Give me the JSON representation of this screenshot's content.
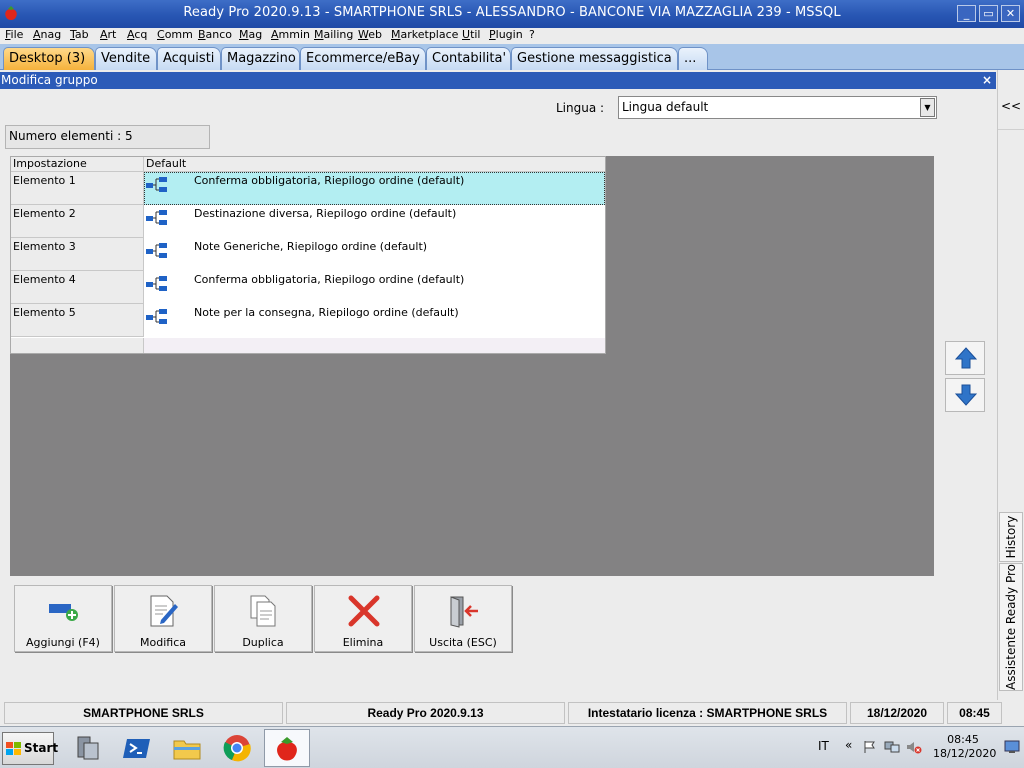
{
  "window": {
    "title": "Ready Pro 2020.9.13 - SMARTPHONE SRLS - ALESSANDRO - BANCONE VIA MAZZAGLIA 239 - MSSQL",
    "controls": [
      "_",
      "▭",
      "✕"
    ]
  },
  "menu": [
    "File",
    "Anag",
    "Tab",
    "Art",
    "Acq",
    "Comm",
    "Banco",
    "Mag",
    "Ammin",
    "Mailing",
    "Web",
    "Marketplace",
    "Util",
    "Plugin",
    "?"
  ],
  "tabs": [
    "Desktop (3)",
    "Vendite",
    "Acquisti",
    "Magazzino",
    "Ecommerce/eBay",
    "Contabilita'",
    "Gestione messaggistica",
    "..."
  ],
  "active_tab_index": 0,
  "subwindow": {
    "title": "Modifica gruppo",
    "close": "×"
  },
  "language": {
    "label": "Lingua :",
    "value": "Lingua default"
  },
  "count_label": "Numero elementi : 5",
  "grid": {
    "headers": [
      "Impostazione",
      "Default"
    ],
    "rows": [
      {
        "label": "Elemento 1",
        "value": "Conferma obbligatoria, Riepilogo ordine (default)",
        "selected": true
      },
      {
        "label": "Elemento 2",
        "value": "Destinazione diversa, Riepilogo ordine (default)",
        "selected": false
      },
      {
        "label": "Elemento 3",
        "value": "Note Generiche, Riepilogo ordine (default)",
        "selected": false
      },
      {
        "label": "Elemento 4",
        "value": "Conferma obbligatoria, Riepilogo ordine (default)",
        "selected": false
      },
      {
        "label": "Elemento 5",
        "value": "Note per la consegna, Riepilogo ordine (default)",
        "selected": false
      }
    ]
  },
  "toolbar": {
    "add": "Aggiungi (F4)",
    "edit": "Modifica",
    "duplicate": "Duplica",
    "delete": "Elimina",
    "exit": "Uscita (ESC)"
  },
  "side_panel": {
    "collapse": "<<",
    "history": "History",
    "assistant": "Assistente Ready Pro"
  },
  "statusbar": {
    "company": "SMARTPHONE SRLS",
    "version": "Ready Pro 2020.9.13",
    "license": "Intestatario licenza : SMARTPHONE SRLS",
    "date": "18/12/2020",
    "time": "08:45"
  },
  "taskbar": {
    "start": "Start",
    "lang": "IT",
    "clock_time": "08:45",
    "clock_date": "18/12/2020",
    "tray_chevron": "«"
  },
  "icons": {
    "app": "strawberry-icon",
    "row": "tree-hierarchy-icon",
    "up": "arrow-up-icon",
    "down": "arrow-down-icon"
  },
  "colors": {
    "titlebar": "#2856b3",
    "active_tab": "#f5b23c",
    "selected_row": "#b3eef2",
    "grid_background": "#838283",
    "delete_red": "#d9362b",
    "arrow_blue": "#2f74c8"
  }
}
